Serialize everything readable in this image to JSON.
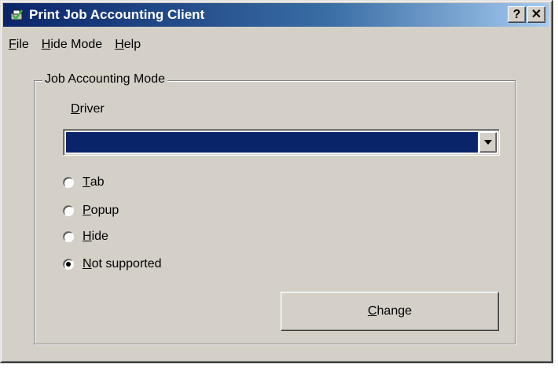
{
  "window": {
    "title": "Print Job Accounting Client",
    "help_button": "?",
    "close_button": "✕"
  },
  "menu": {
    "file": {
      "mnemonic": "F",
      "rest": "ile"
    },
    "hide_mode": {
      "mnemonic": "H",
      "rest": "ide Mode"
    },
    "help": {
      "mnemonic": "H",
      "rest": "elp"
    }
  },
  "group": {
    "label": "Job Accounting Mode",
    "driver_label": {
      "mnemonic": "D",
      "rest": "river"
    },
    "driver_value": ""
  },
  "radios": {
    "tab": {
      "mnemonic": "T",
      "rest": "ab",
      "checked": false
    },
    "popup": {
      "mnemonic": "P",
      "rest": "opup",
      "checked": false
    },
    "hide": {
      "mnemonic": "H",
      "rest": "ide",
      "checked": false
    },
    "not_supported": {
      "mnemonic": "N",
      "rest": "ot supported",
      "checked": true
    }
  },
  "change_button": {
    "mnemonic": "C",
    "rest": "hange"
  },
  "colors": {
    "face": "#d4d0c8",
    "title_start": "#0a246a",
    "title_end": "#a6caf0",
    "selection": "#0a246a"
  }
}
